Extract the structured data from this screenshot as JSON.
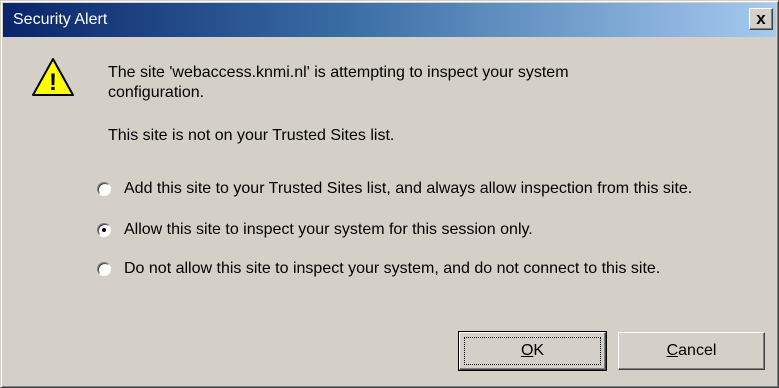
{
  "window": {
    "title": "Security Alert",
    "close_label": "x"
  },
  "icon": {
    "name": "warning-icon",
    "glyph": "!",
    "colors": {
      "fill": "#ffff00",
      "outline": "#000000"
    }
  },
  "message": {
    "line1": "The site 'webaccess.knmi.nl' is attempting to inspect your system",
    "line2": "configuration.",
    "line3": "This site is not on your Trusted Sites list."
  },
  "options": [
    {
      "label": "Add this site to your Trusted Sites list, and always allow inspection from this site.",
      "selected": false
    },
    {
      "label": "Allow this site to inspect your system for this session only.",
      "selected": true
    },
    {
      "label": "Do not allow this site to inspect your system, and do not connect to this site.",
      "selected": false
    }
  ],
  "buttons": {
    "ok_mnemonic": "O",
    "ok_rest": "K",
    "cancel_mnemonic": "C",
    "cancel_rest": "ancel"
  },
  "colors": {
    "title_gradient_start": "#0a246a",
    "title_gradient_end": "#a6caf0",
    "face": "#d4d0c8"
  }
}
